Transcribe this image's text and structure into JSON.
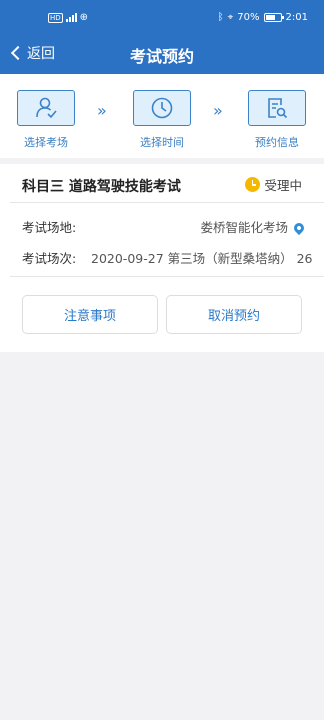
{
  "status_bar": {
    "hd": "HD",
    "battery_percent": "70%",
    "time": "2:01"
  },
  "nav": {
    "back_label": "返回",
    "title": "考试预约"
  },
  "steps": [
    {
      "label": "选择考场",
      "icon": "user-check-icon"
    },
    {
      "label": "选择时间",
      "icon": "clock-icon"
    },
    {
      "label": "预约信息",
      "icon": "document-search-icon"
    }
  ],
  "step_separator": "»",
  "booking": {
    "subject": "科目三 道路驾驶技能考试",
    "status": "受理中",
    "venue_label": "考试场地:",
    "venue_value": "娄桥智能化考场",
    "session_label": "考试场次:",
    "session_value": "2020-09-27 第三场（新型桑塔纳） 26"
  },
  "actions": {
    "notes_label": "注意事项",
    "cancel_label": "取消预约"
  },
  "colors": {
    "primary": "#2b72c4",
    "accent_text": "#2a78c8",
    "status_icon": "#f5b800",
    "pin": "#2e8fd8"
  }
}
